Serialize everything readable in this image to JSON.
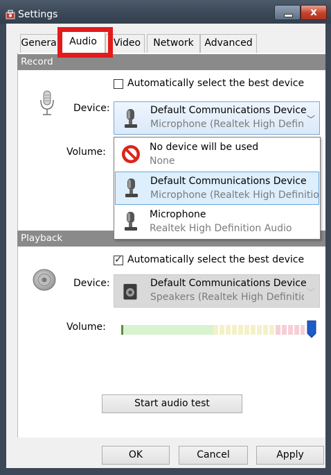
{
  "window": {
    "title": "Settings"
  },
  "title_controls": {
    "close_label": "x"
  },
  "tabs": [
    {
      "label": "General",
      "active": false
    },
    {
      "label": "Audio",
      "active": true
    },
    {
      "label": "Video",
      "active": false
    },
    {
      "label": "Network",
      "active": false
    },
    {
      "label": "Advanced",
      "active": false
    }
  ],
  "record": {
    "header": "Record",
    "auto_select_label": "Automatically select the best device",
    "auto_select_checked": false,
    "device_label": "Device:",
    "selected_device": {
      "name": "Default Communications Device",
      "detail": "Microphone (Realtek High Definition Audio)",
      "icon": "microphone-device-icon"
    },
    "volume_label": "Volume:",
    "dropdown_options": [
      {
        "name": "No device will be used",
        "detail": "None",
        "icon": "no-entry-icon",
        "selected": false
      },
      {
        "name": "Default Communications Device",
        "detail": "Microphone (Realtek High Definition Audio)",
        "icon": "microphone-device-icon",
        "selected": true
      },
      {
        "name": "Microphone",
        "detail": "Realtek High Definition Audio",
        "icon": "microphone-device-icon",
        "selected": false
      }
    ]
  },
  "playback": {
    "header": "Playback",
    "auto_select_label": "Automatically select the best device",
    "auto_select_checked": true,
    "device_label": "Device:",
    "selected_device": {
      "name": "Default Communications Device",
      "detail": "Speakers (Realtek High Definition Audio)",
      "icon": "speaker-device-icon"
    },
    "volume_label": "Volume:",
    "volume_level": 1.0
  },
  "audio_test_button": "Start audio test",
  "footer": {
    "ok": "OK",
    "cancel": "Cancel",
    "apply": "Apply"
  },
  "colors": {
    "accent_highlight": "#e21b1b",
    "section_header": "#8a8a8a",
    "selection_border": "#6aa7dc",
    "selection_fill": "#ddeefc",
    "volume_thumb": "#1e5bc6"
  }
}
